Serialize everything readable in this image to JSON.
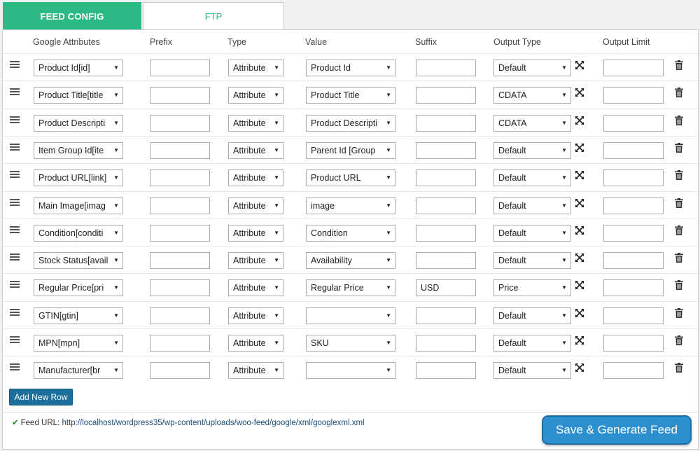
{
  "tabs": [
    {
      "label": "FEED CONFIG"
    },
    {
      "label": "FTP"
    }
  ],
  "columns": {
    "google_attributes": "Google Attributes",
    "prefix": "Prefix",
    "type": "Type",
    "value": "Value",
    "suffix": "Suffix",
    "output_type": "Output Type",
    "output_limit": "Output Limit"
  },
  "rows": [
    {
      "attribute": "Product Id[id]",
      "prefix": "",
      "type": "Attribute",
      "value": "Product Id",
      "suffix": "",
      "output_type": "Default",
      "limit": ""
    },
    {
      "attribute": "Product Title[title",
      "prefix": "",
      "type": "Attribute",
      "value": "Product Title",
      "suffix": "",
      "output_type": "CDATA",
      "limit": ""
    },
    {
      "attribute": "Product Descripti",
      "prefix": "",
      "type": "Attribute",
      "value": "Product Descripti",
      "suffix": "",
      "output_type": "CDATA",
      "limit": ""
    },
    {
      "attribute": "Item Group Id[ite",
      "prefix": "",
      "type": "Attribute",
      "value": "Parent Id [Group",
      "suffix": "",
      "output_type": "Default",
      "limit": ""
    },
    {
      "attribute": "Product URL[link]",
      "prefix": "",
      "type": "Attribute",
      "value": "Product URL",
      "suffix": "",
      "output_type": "Default",
      "limit": ""
    },
    {
      "attribute": "Main Image[imag",
      "prefix": "",
      "type": "Attribute",
      "value": "image",
      "suffix": "",
      "output_type": "Default",
      "limit": ""
    },
    {
      "attribute": "Condition[conditi",
      "prefix": "",
      "type": "Attribute",
      "value": "Condition",
      "suffix": "",
      "output_type": "Default",
      "limit": ""
    },
    {
      "attribute": "Stock Status[avail",
      "prefix": "",
      "type": "Attribute",
      "value": "Availability",
      "suffix": "",
      "output_type": "Default",
      "limit": ""
    },
    {
      "attribute": "Regular Price[pri",
      "prefix": "",
      "type": "Attribute",
      "value": "Regular Price",
      "suffix": "USD",
      "output_type": "Price",
      "limit": ""
    },
    {
      "attribute": "GTIN[gtin]",
      "prefix": "",
      "type": "Attribute",
      "value": "",
      "suffix": "",
      "output_type": "Default",
      "limit": ""
    },
    {
      "attribute": "MPN[mpn]",
      "prefix": "",
      "type": "Attribute",
      "value": "SKU",
      "suffix": "",
      "output_type": "Default",
      "limit": ""
    },
    {
      "attribute": "Manufacturer[br",
      "prefix": "",
      "type": "Attribute",
      "value": "",
      "suffix": "",
      "output_type": "Default",
      "limit": ""
    }
  ],
  "buttons": {
    "add_row": "Add New Row",
    "save": "Save & Generate Feed"
  },
  "feed": {
    "label": "Feed URL:",
    "url": "http://localhost/wordpress35/wp-content/uploads/woo-feed/google/xml/googlexml.xml"
  },
  "icons": {
    "drag": "drag-handle-icon",
    "expand": "expand-icon",
    "trash": "trash-icon",
    "check": "check-icon",
    "dropdown": "chevron-down-icon"
  },
  "colors": {
    "tab_active": "#2bba84",
    "button_primary": "#1b6f9a",
    "save_button": "#2e8fcf",
    "link": "#1a4f7a"
  }
}
